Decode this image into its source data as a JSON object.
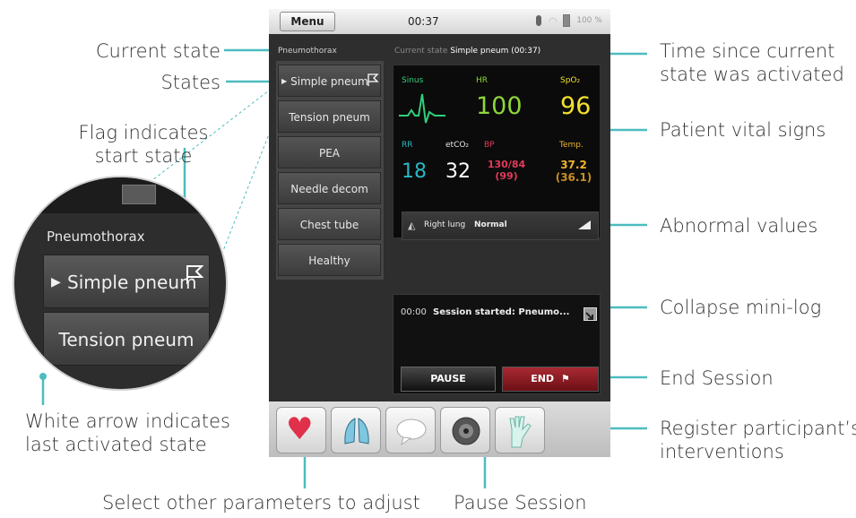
{
  "device": {
    "menu_label": "Menu",
    "clock": "00:37",
    "battery_text": "100 %",
    "scenario_title": "Pneumothorax",
    "current_state_prefix": "Current state",
    "current_state_value": "Simple pneum (00:37)"
  },
  "states": [
    {
      "label": "Simple pneum",
      "active": true,
      "start_flag": true
    },
    {
      "label": "Tension pneum"
    },
    {
      "label": "PEA"
    },
    {
      "label": "Needle decom"
    },
    {
      "label": "Chest tube"
    },
    {
      "label": "Healthy"
    }
  ],
  "vitals": {
    "rhythm_label": "Sinus",
    "hr_label": "HR",
    "hr_value": "100",
    "spo2_label": "SpO₂",
    "spo2_value": "96",
    "rr_label": "RR",
    "rr_value": "18",
    "etco2_label": "etCO₂",
    "etco2_value": "32",
    "bp_label": "BP",
    "bp_value": "130/84",
    "bp_map": "(99)",
    "temp_label": "Temp.",
    "temp_value": "37.2",
    "temp_sub": "(36.1)"
  },
  "abnormal": {
    "prefix": "Right lung",
    "value": "Normal"
  },
  "minilog": {
    "time": "00:00",
    "text": "Session started: Pneumo..."
  },
  "buttons": {
    "pause": "PAUSE",
    "end": "END"
  },
  "tools": [
    "heart-icon",
    "lungs-icon",
    "speech-bubble-icon",
    "sound-icon",
    "gloves-icon"
  ],
  "magnifier": {
    "title": "Pneumothorax",
    "btn1": "Simple pneum",
    "btn2": "Tension pneum"
  },
  "callouts": {
    "current_state": "Current state",
    "states": "States",
    "flag_line1": "Flag indicates",
    "flag_line2": "start state",
    "arrow_line1": "White arrow indicates",
    "arrow_line2": "last activated state",
    "select_params": "Select other parameters to adjust",
    "pause_session": "Pause Session",
    "time_line1": "Time since current",
    "time_line2": "state was activated",
    "vitals": "Patient vital signs",
    "abnormal": "Abnormal values",
    "collapse": "Collapse mini-log",
    "end_session": "End Session",
    "register_line1": "Register participant’s",
    "register_line2": "interventions"
  },
  "colors": {
    "accent": "#4dbcbf",
    "sinus": "#2fd07a",
    "hr": "#8ed63a",
    "spo2": "#f2e12b",
    "rr": "#2ab8c2",
    "bp": "#e23a5a",
    "temp": "#f1b42b",
    "temp_sub": "#c98f22",
    "end_red": "#8e1a22"
  }
}
